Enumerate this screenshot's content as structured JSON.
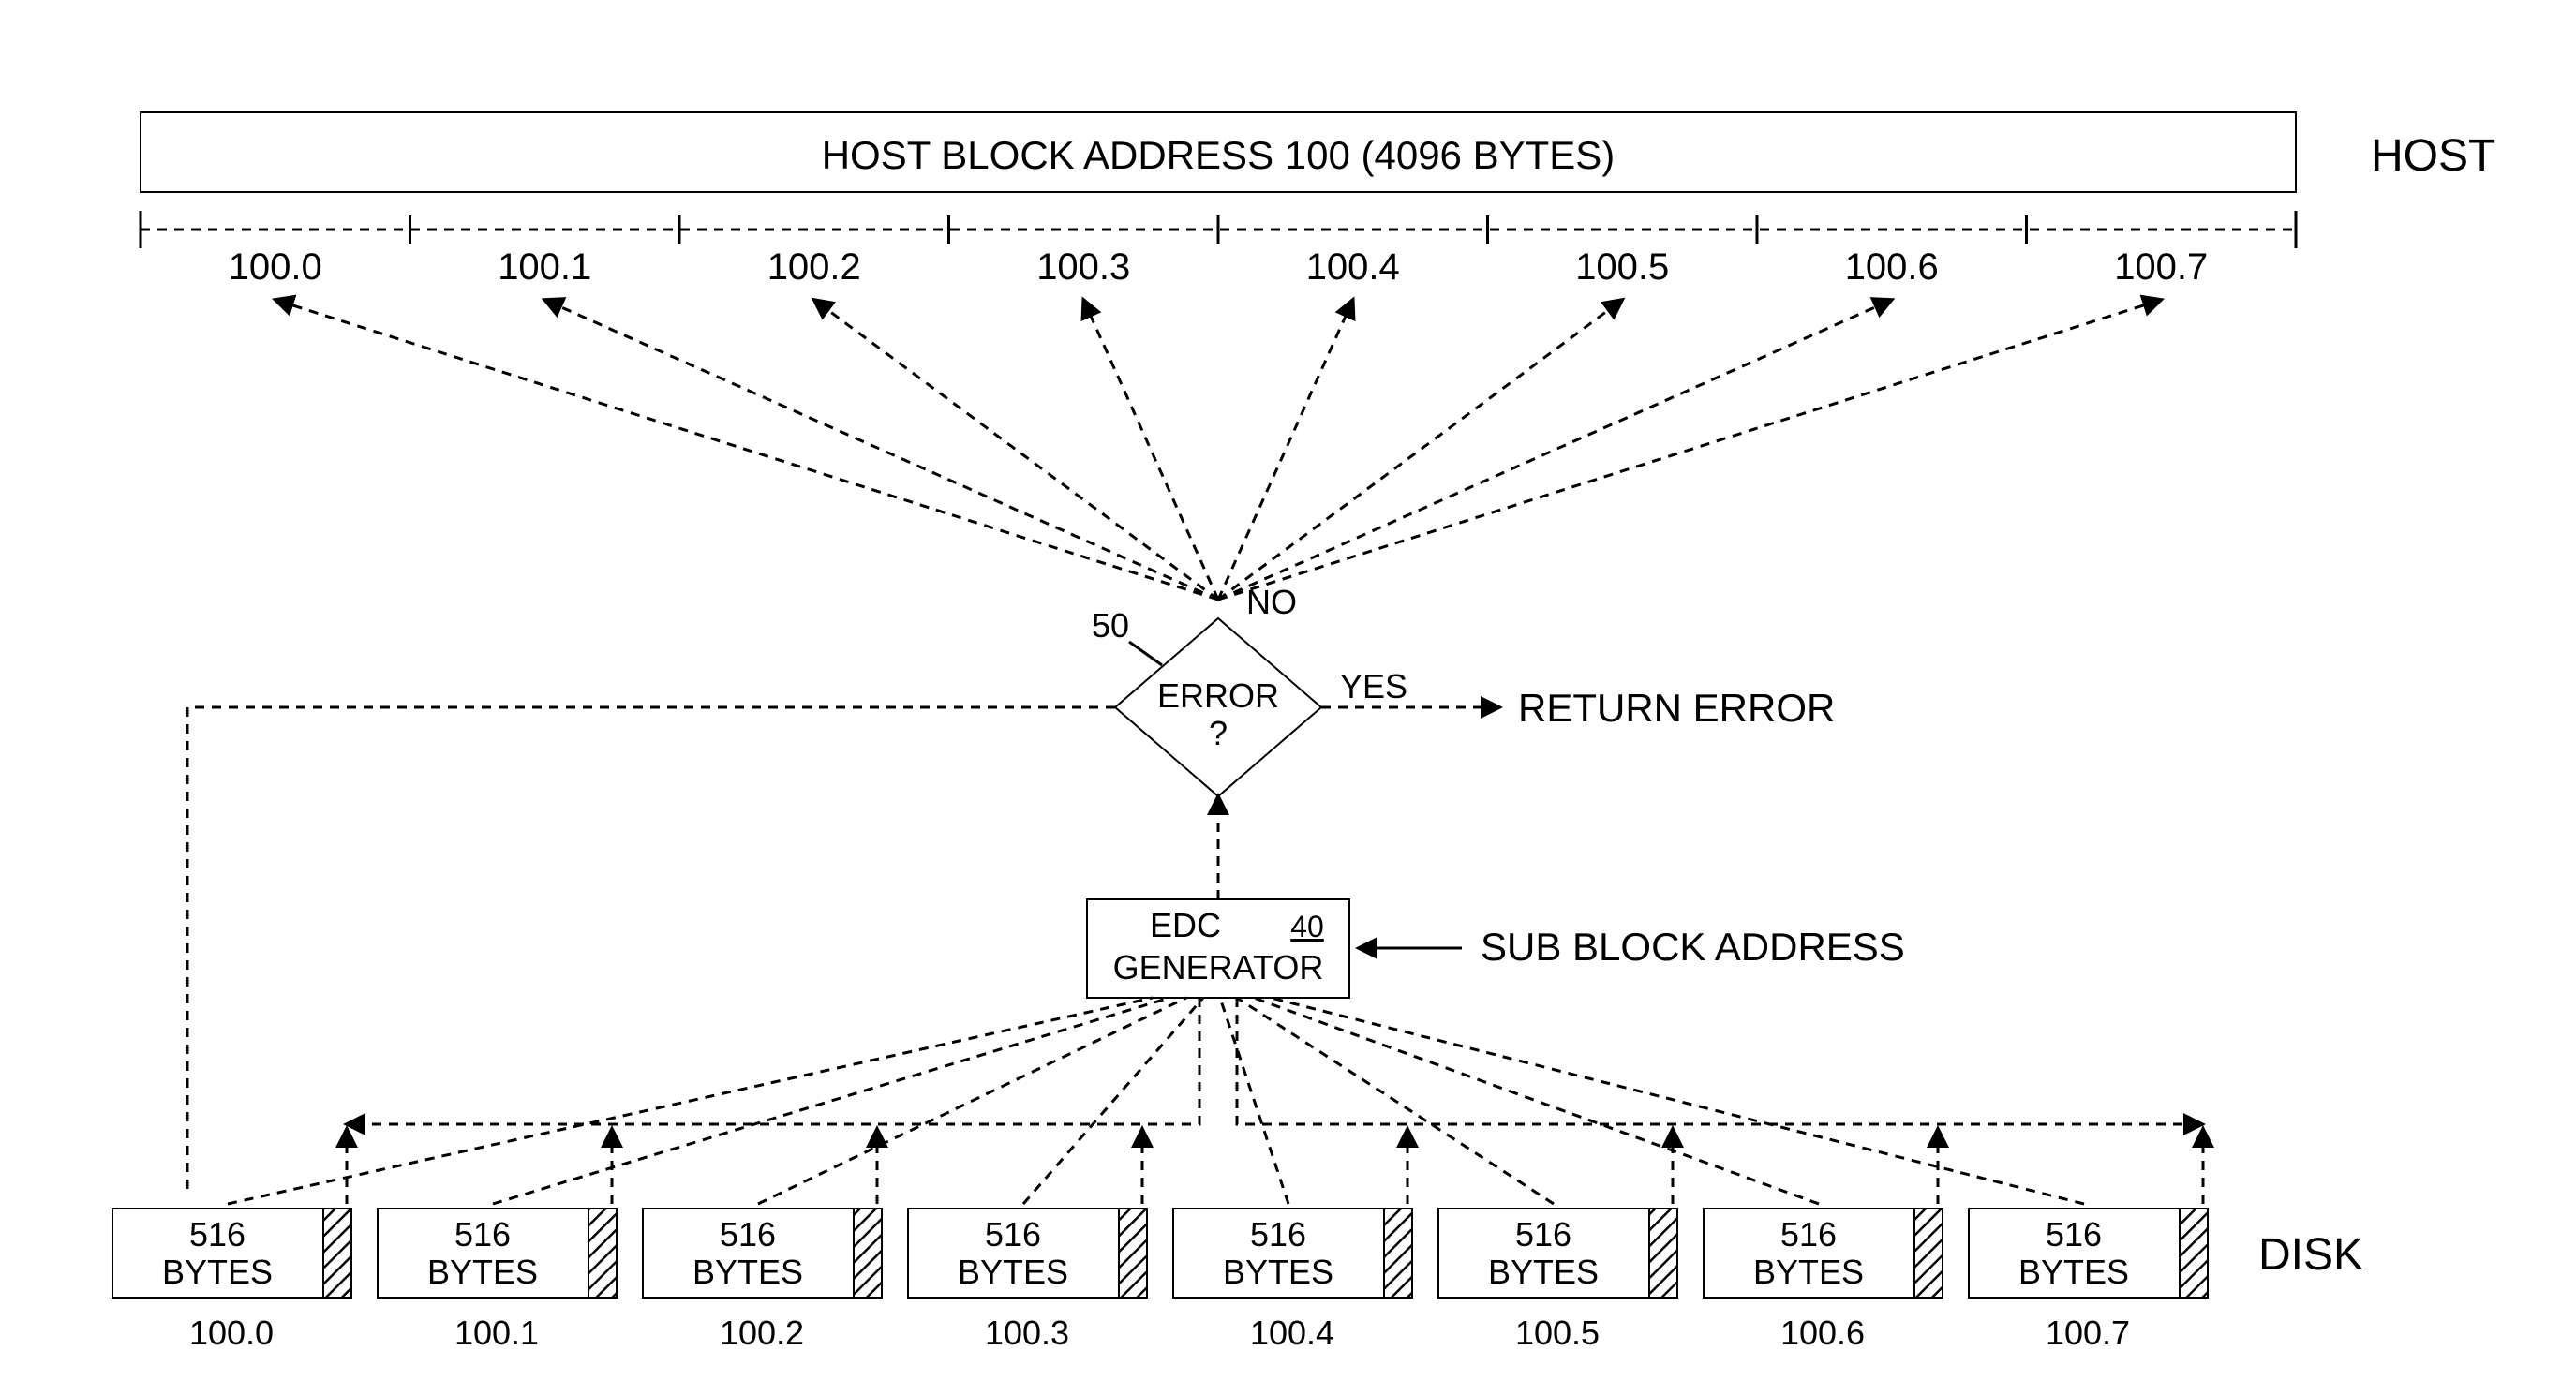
{
  "host_block_label": "HOST BLOCK ADDRESS 100 (4096 BYTES)",
  "host_label": "HOST",
  "disk_label": "DISK",
  "host_ticks": [
    "100.0",
    "100.1",
    "100.2",
    "100.3",
    "100.4",
    "100.5",
    "100.6",
    "100.7"
  ],
  "decision": {
    "ref": "50",
    "text_top": "ERROR",
    "text_bot": "?",
    "no": "NO",
    "yes": "YES"
  },
  "return_error": "RETURN ERROR",
  "edc": {
    "line1": "EDC",
    "line2": "GENERATOR",
    "ref": "40"
  },
  "sub_block_address": "SUB BLOCK ADDRESS",
  "disk_blocks": {
    "size_top": "516",
    "size_bot": "BYTES",
    "addrs": [
      "100.0",
      "100.1",
      "100.2",
      "100.3",
      "100.4",
      "100.5",
      "100.6",
      "100.7"
    ]
  }
}
